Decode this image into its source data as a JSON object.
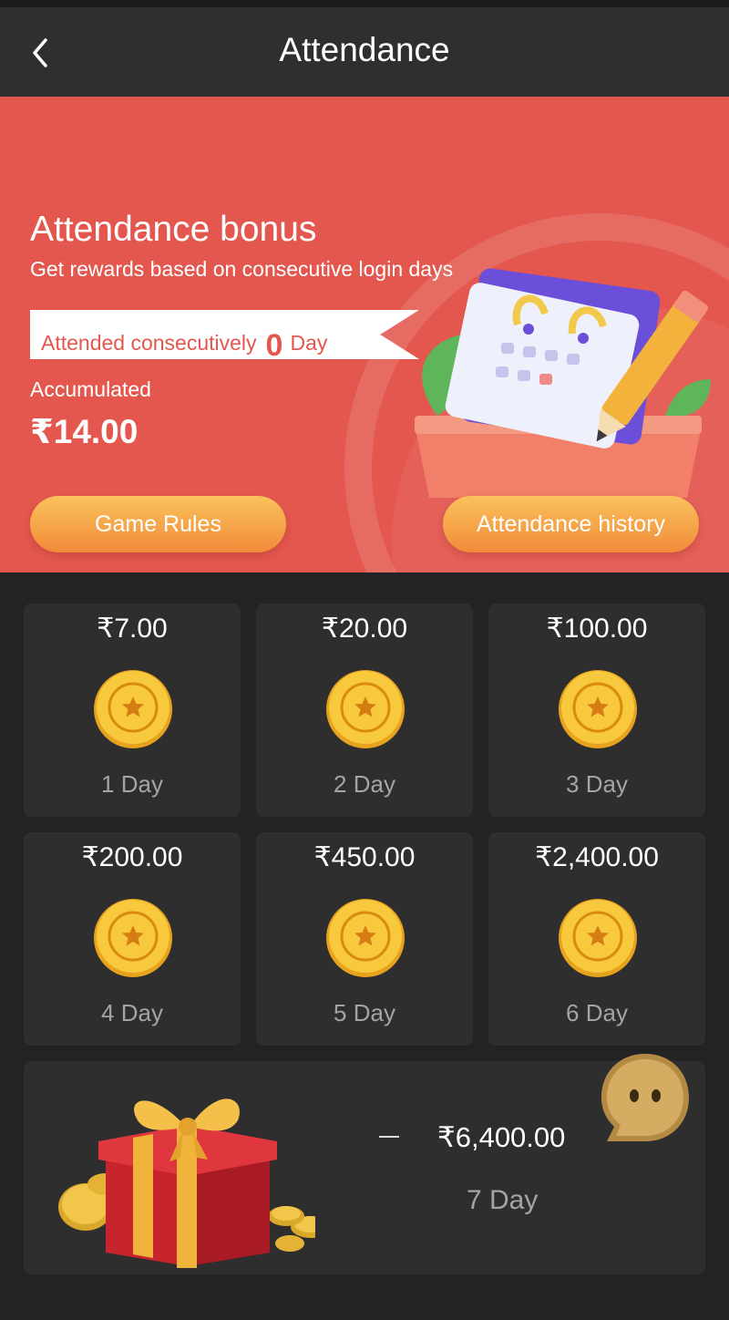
{
  "header": {
    "title": "Attendance",
    "back_icon": "chevron-left-icon"
  },
  "banner": {
    "title": "Attendance bonus",
    "subtitle": "Get rewards based on consecutive login days",
    "ribbon_prefix": "Attended consecutively",
    "ribbon_count": "0",
    "ribbon_suffix": "Day",
    "accumulated_label": "Accumulated",
    "accumulated_value": "₹14.00",
    "rules_button": "Game Rules",
    "history_button": "Attendance history"
  },
  "days": [
    {
      "amount": "₹7.00",
      "label": "1 Day"
    },
    {
      "amount": "₹20.00",
      "label": "2 Day"
    },
    {
      "amount": "₹100.00",
      "label": "3 Day"
    },
    {
      "amount": "₹200.00",
      "label": "4 Day"
    },
    {
      "amount": "₹450.00",
      "label": "5 Day"
    },
    {
      "amount": "₹2,400.00",
      "label": "6 Day"
    }
  ],
  "final_day": {
    "amount": "₹6,400.00",
    "label": "7 Day"
  },
  "colors": {
    "banner": "#e3574e",
    "button": "#f6a94a",
    "card": "#2e2e2e",
    "page": "#232323"
  }
}
